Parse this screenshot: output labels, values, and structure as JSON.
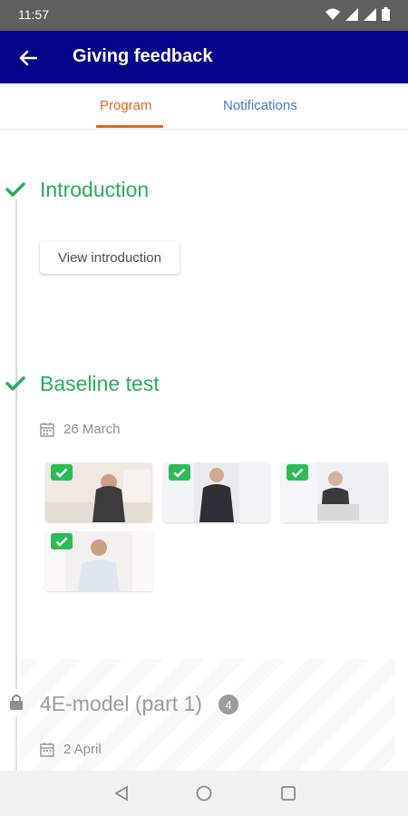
{
  "status_bar": {
    "time": "11:57"
  },
  "app_bar": {
    "title": "Giving feedback"
  },
  "tabs": [
    {
      "label": "Program",
      "active": true
    },
    {
      "label": "Notifications",
      "active": false
    }
  ],
  "sections": [
    {
      "title": "Introduction",
      "status": "completed",
      "button_label": "View introduction"
    },
    {
      "title": "Baseline test",
      "status": "completed",
      "date": "26 March",
      "videos_completed": 4
    },
    {
      "title": "4E-model (part 1)",
      "status": "locked",
      "badge": "4",
      "date": "2 April"
    }
  ],
  "colors": {
    "app_bar": "#06048b",
    "tab_active": "#e8651a",
    "tab_inactive": "#3f7ac7",
    "completed": "#27ae60",
    "locked": "#9c9c9c"
  }
}
